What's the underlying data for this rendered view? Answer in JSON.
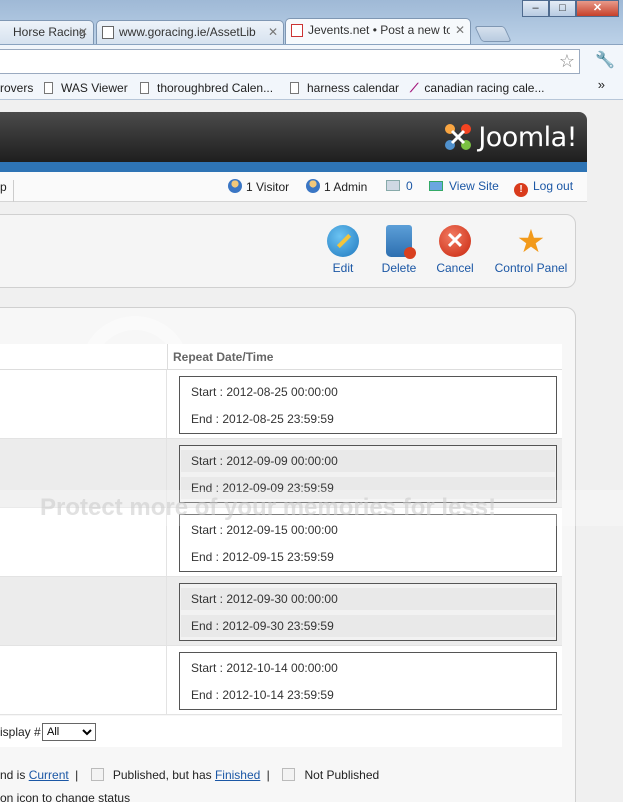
{
  "browser": {
    "tabs": [
      {
        "label": "Horse Racing I",
        "active": false
      },
      {
        "label": "www.goracing.ie/AssetLib",
        "active": false
      },
      {
        "label": "Jevents.net • Post a new to",
        "active": true
      }
    ],
    "window_controls": {
      "minimize": "–",
      "maximize": "□",
      "close": "✕"
    },
    "bookmarks": [
      {
        "label": "rovers"
      },
      {
        "label": "WAS Viewer"
      },
      {
        "label": "thoroughbred Calen..."
      },
      {
        "label": "harness calendar"
      },
      {
        "label": "canadian racing cale..."
      }
    ],
    "bookmarks_more": "»"
  },
  "joomla": {
    "logo_text": "Joomla!",
    "status": {
      "left_fragment": "p",
      "visitors": "1 Visitor",
      "admins": "1 Admin",
      "messages": "0",
      "view_site": "View Site",
      "logout": "Log out"
    },
    "toolbar": {
      "edit": "Edit",
      "delete": "Delete",
      "cancel": "Cancel",
      "control_panel": "Control Panel"
    }
  },
  "grid": {
    "header": "Repeat Date/Time",
    "rows": [
      {
        "start": "Start : 2012-08-25 00:00:00",
        "end": "End : 2012-08-25 23:59:59"
      },
      {
        "start": "Start : 2012-09-09 00:00:00",
        "end": "End : 2012-09-09 23:59:59"
      },
      {
        "start": "Start : 2012-09-15 00:00:00",
        "end": "End : 2012-09-15 23:59:59"
      },
      {
        "start": "Start : 2012-09-30 00:00:00",
        "end": "End : 2012-09-30 23:59:59"
      },
      {
        "start": "Start : 2012-10-14 00:00:00",
        "end": "End : 2012-10-14 23:59:59"
      }
    ]
  },
  "pager": {
    "label": "isplay #",
    "selected": "All"
  },
  "legend": {
    "prefix": "nd is",
    "current": "Current",
    "sep": "|",
    "published_finished_prefix": "Published, but has",
    "finished": "Finished",
    "not_published": "Not Published",
    "hint": "on icon to change status"
  },
  "watermark": "Protect more of your memories for less!"
}
